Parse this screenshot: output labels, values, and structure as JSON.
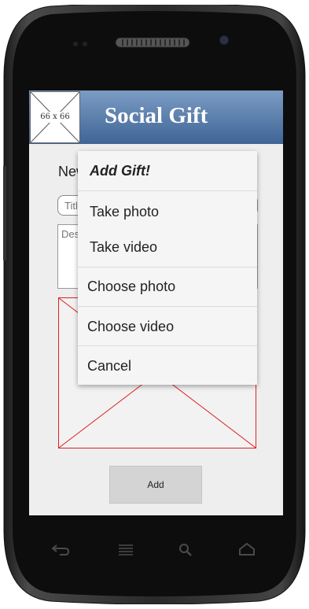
{
  "header": {
    "logo_label": "66 x 66",
    "title": "Social Gift"
  },
  "form": {
    "heading": "New",
    "title_placeholder": "Title",
    "description_placeholder": "Description",
    "add_label": "Add"
  },
  "popup": {
    "title": "Add Gift!",
    "items": [
      {
        "label": "Take photo"
      },
      {
        "label": "Take video"
      },
      {
        "label": "Choose photo"
      },
      {
        "label": "Choose video"
      },
      {
        "label": "Cancel"
      }
    ]
  },
  "nav": {
    "icons": [
      "back-icon",
      "home-icon",
      "search-icon",
      "menu-icon"
    ]
  },
  "colors": {
    "header_top": "#7b9cc4",
    "header_bottom": "#3f6596",
    "placeholder_border": "#e02020"
  }
}
